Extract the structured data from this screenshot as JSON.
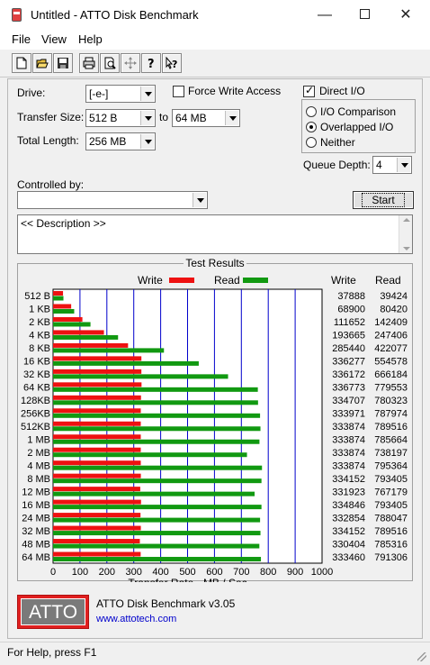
{
  "window": {
    "title": "Untitled - ATTO Disk Benchmark",
    "minimize": "—",
    "close": "✕"
  },
  "menu": [
    "File",
    "View",
    "Help"
  ],
  "toolbar_icons": [
    "new-file-icon",
    "open-folder-icon",
    "save-icon",
    "print-icon",
    "print-preview-icon",
    "move-icon",
    "help-icon",
    "context-help-icon"
  ],
  "settings": {
    "drive_label": "Drive:",
    "drive_value": "[-e-]",
    "transfer_size_label": "Transfer Size:",
    "transfer_from": "512 B",
    "transfer_to_label": "to",
    "transfer_to": "64 MB",
    "total_length_label": "Total Length:",
    "total_length": "256 MB",
    "force_write_access": "Force Write Access",
    "direct_io": "Direct I/O",
    "io_comparison": "I/O Comparison",
    "overlapped_io": "Overlapped I/O",
    "neither": "Neither",
    "queue_depth_label": "Queue Depth:",
    "queue_depth": "4",
    "controlled_by_label": "Controlled by:",
    "start_button": "Start",
    "description": "<< Description >>"
  },
  "colors": {
    "write": "#ee1111",
    "read": "#119911",
    "grid": "#0000cc"
  },
  "results": {
    "title": "Test Results",
    "legend_write": "Write",
    "legend_read": "Read",
    "col_write": "Write",
    "col_read": "Read"
  },
  "chart_data": {
    "type": "bar",
    "orientation": "horizontal",
    "categories": [
      "512 B",
      "1 KB",
      "2 KB",
      "4 KB",
      "8 KB",
      "16 KB",
      "32 KB",
      "64 KB",
      "128KB",
      "256KB",
      "512KB",
      "1 MB",
      "2 MB",
      "4 MB",
      "8 MB",
      "12 MB",
      "16 MB",
      "24 MB",
      "32 MB",
      "48 MB",
      "64 MB"
    ],
    "series": [
      {
        "name": "Write",
        "values": [
          37888,
          68900,
          111652,
          193665,
          285440,
          336277,
          336172,
          336773,
          334707,
          333971,
          333874,
          333874,
          333874,
          333874,
          334152,
          331923,
          334846,
          332854,
          334152,
          330404,
          333460
        ]
      },
      {
        "name": "Read",
        "values": [
          39424,
          80420,
          142409,
          247406,
          422077,
          554578,
          666184,
          779553,
          780323,
          787974,
          789516,
          785664,
          738197,
          795364,
          793405,
          767179,
          793405,
          788047,
          789516,
          785316,
          791306
        ]
      }
    ],
    "xlabel": "Transfer Rate - MB / Sec",
    "xlim": [
      0,
      1000
    ],
    "xticks": [
      "0",
      "100",
      "200",
      "300",
      "400",
      "500",
      "600",
      "700",
      "800",
      "900",
      "1000"
    ]
  },
  "branding": {
    "logo_text": "ATTO",
    "product": "ATTO Disk Benchmark v3.05",
    "url": "www.attotech.com"
  },
  "status": "For Help, press F1"
}
